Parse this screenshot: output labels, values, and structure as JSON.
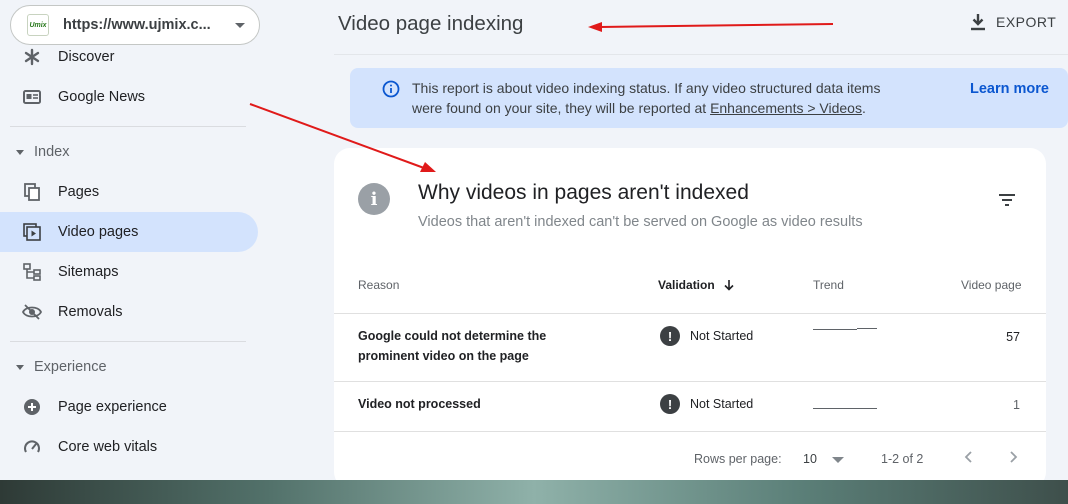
{
  "property": {
    "logo_text": "Umix",
    "url": "https://www.ujmix.c..."
  },
  "sidebar": {
    "items_top": [
      {
        "label": "Discover",
        "icon": "asterisk-icon"
      },
      {
        "label": "Google News",
        "icon": "news-icon"
      }
    ],
    "index": {
      "label": "Index",
      "items": [
        {
          "label": "Pages",
          "icon": "pages-icon"
        },
        {
          "label": "Video pages",
          "icon": "video-pages-icon",
          "active": true
        },
        {
          "label": "Sitemaps",
          "icon": "sitemap-icon"
        },
        {
          "label": "Removals",
          "icon": "eye-off-icon"
        }
      ]
    },
    "experience": {
      "label": "Experience",
      "items": [
        {
          "label": "Page experience",
          "icon": "plus-circle-icon"
        },
        {
          "label": "Core web vitals",
          "icon": "gauge-icon"
        }
      ]
    }
  },
  "header": {
    "title": "Video page indexing",
    "export_label": "EXPORT"
  },
  "banner": {
    "text_line1": "This report is about video indexing status. If any video structured data items",
    "text_line2_prefix": "were found on your site, they will be reported at ",
    "link_text": "Enhancements > Videos",
    "text_line2_suffix": ".",
    "learn_more": "Learn more"
  },
  "card": {
    "title": "Why videos in pages aren't indexed",
    "subtitle": "Videos that aren't indexed can't be served on Google as video results",
    "columns": {
      "reason": "Reason",
      "validation": "Validation",
      "trend": "Trend",
      "video_page": "Video page"
    },
    "rows": [
      {
        "reason": "Google could not determine the prominent video on the page",
        "validation": "Not Started",
        "count": "57"
      },
      {
        "reason": "Video not processed",
        "validation": "Not Started",
        "count": "1"
      }
    ],
    "pagination": {
      "rows_per_page_label": "Rows per page:",
      "rows_per_page_value": "10",
      "range": "1-2 of 2"
    }
  },
  "colors": {
    "accent": "#0b57d0",
    "active_nav": "#d3e3fd",
    "annotation_arrow": "#e01a1a"
  }
}
